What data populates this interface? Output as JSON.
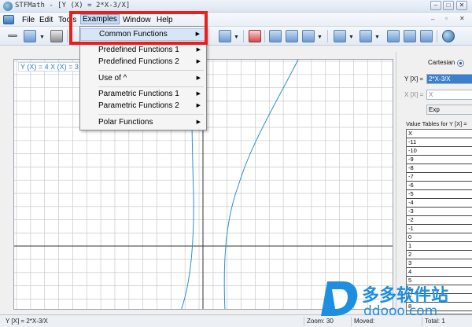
{
  "window": {
    "title": "STFMath - [Y (X) = 2*X-3/X]",
    "minimize_glyph": "–",
    "maximize_glyph": "□",
    "close_glyph": "✕"
  },
  "menu": [
    "File",
    "Edit",
    "Tools",
    "Examples",
    "Window",
    "Help"
  ],
  "examples_menu": [
    {
      "label": "Common Functions",
      "submenu": true
    },
    {
      "label": "Predefined Functions 1",
      "submenu": true
    },
    {
      "label": "Predefined Functions 2",
      "submenu": true
    },
    {
      "label": "Use of ^",
      "submenu": true
    },
    {
      "label": "Parametric Functions 1",
      "submenu": true
    },
    {
      "label": "Parametric Functions 2",
      "submenu": true
    },
    {
      "label": "Polar Functions",
      "submenu": true
    }
  ],
  "submenu_arrow": "▶",
  "toolbar_icons": [
    "new-icon",
    "print-icon",
    "zoom-icon",
    "eraser-icon",
    "axes-icon",
    "grid-icon",
    "color-icon",
    "chart-icon",
    "settings-globe-icon"
  ],
  "graph": {
    "formula_label": "Y (X) = 4  X (X) = 3"
  },
  "side_panel": {
    "mode_label": "Cartesian",
    "y_label": "Y [X] =",
    "y_value": "2*X-3/X",
    "x_label": "X [X] =",
    "x_value": "X",
    "exp_label": "Exp",
    "table_title": "Value Tables for Y [X] =",
    "table_header": "X",
    "table_rows": [
      "-11",
      "-10",
      "-9",
      "-8",
      "-7",
      "-6",
      "-5",
      "-4",
      "-3",
      "-2",
      "-1",
      "0",
      "1",
      "2",
      "3",
      "4",
      "5",
      "6",
      "7",
      "8"
    ]
  },
  "status": {
    "formula": "Y [X] = 2*X-3/X",
    "zoom": "Zoom: 30",
    "moved": "Moved:",
    "total": "Total: 1"
  },
  "watermark": {
    "brand": "多多软件站",
    "url": "ddooo.com"
  },
  "colors": {
    "curve": "#2a8fd0",
    "highlight": "#e8201c",
    "watermark": "#1e8fe0"
  }
}
